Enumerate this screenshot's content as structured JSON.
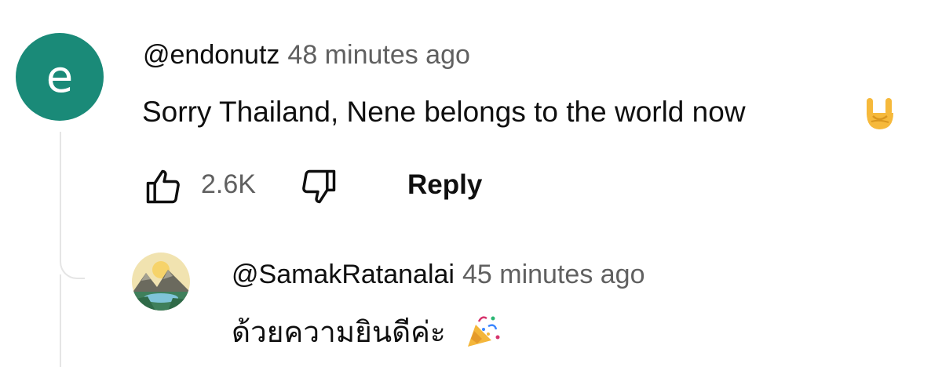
{
  "comment": {
    "avatar_letter": "e",
    "avatar_color": "#1a8a78",
    "handle": "@endonutz",
    "time": "48 minutes ago",
    "text": "Sorry Thailand, Nene belongs to the world now",
    "text_emoji": "sign-of-the-horns-emoji",
    "like_icon": "thumb-up-icon",
    "like_count": "2.6K",
    "dislike_icon": "thumb-down-icon",
    "reply_label": "Reply"
  },
  "reply": {
    "avatar_icon": "landscape-avatar",
    "handle": "@SamakRatanalai",
    "time": "45 minutes ago",
    "text": "ด้วยความยินดีค่ะ",
    "text_emoji": "party-popper-emoji"
  },
  "colors": {
    "text_primary": "#0f0f0f",
    "text_secondary": "#606060",
    "thread_line": "#e5e5e5"
  }
}
